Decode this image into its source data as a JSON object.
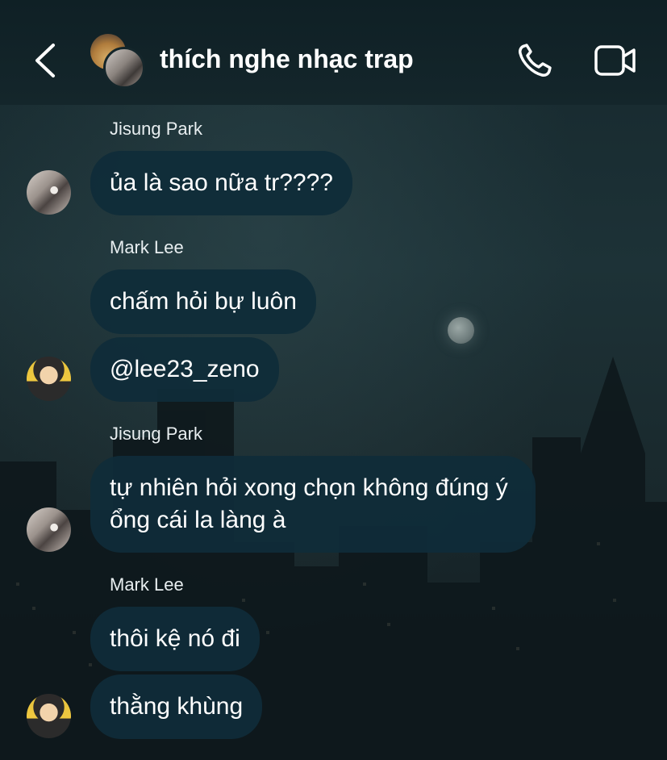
{
  "header": {
    "title": "thích nghe nhạc trap",
    "back_icon": "chevron-left-icon",
    "call_icon": "phone-icon",
    "video_icon": "video-camera-icon"
  },
  "messages": [
    {
      "sender": "Jisung Park",
      "texts": [
        "ủa là sao nữa tr????"
      ]
    },
    {
      "sender": "Mark Lee",
      "texts": [
        "chấm hỏi bự luôn",
        "@lee23_zeno"
      ]
    },
    {
      "sender": "Jisung Park",
      "texts": [
        "tự nhiên hỏi xong chọn không đúng ý",
        "ổng cái la làng à"
      ]
    },
    {
      "sender": "Mark Lee",
      "texts": [
        "thôi kệ nó đi",
        "thằng khùng"
      ]
    }
  ],
  "colors": {
    "bubble": "#0f2c39",
    "header": "#14262b",
    "text": "#ffffff"
  }
}
